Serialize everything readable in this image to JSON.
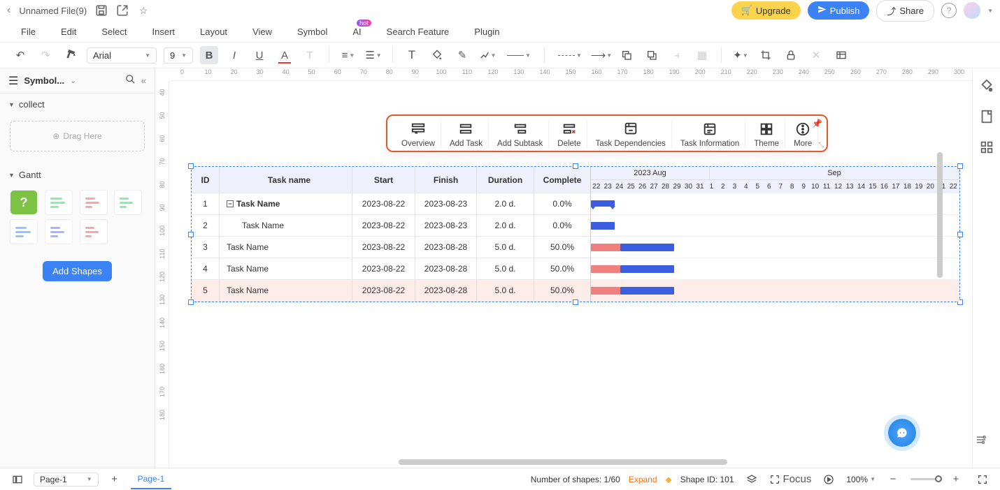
{
  "file": {
    "name": "Unnamed File(9)"
  },
  "topbar": {
    "upgrade": "Upgrade",
    "publish": "Publish",
    "share": "Share"
  },
  "menu": [
    "File",
    "Edit",
    "Select",
    "Insert",
    "Layout",
    "View",
    "Symbol",
    "AI",
    "Search Feature",
    "Plugin"
  ],
  "ai_badge": "hot",
  "toolbar": {
    "font": "Arial",
    "size": "9"
  },
  "sidebar": {
    "title": "Symbol...",
    "collect": "collect",
    "drag": "Drag Here",
    "gantt": "Gantt",
    "add_shapes": "Add Shapes"
  },
  "ruler_h": [
    "0",
    "10",
    "20",
    "30",
    "40",
    "50",
    "60",
    "70",
    "80",
    "90",
    "100",
    "110",
    "120",
    "130",
    "140",
    "150",
    "160",
    "170",
    "180",
    "190",
    "200",
    "210",
    "220",
    "230",
    "240",
    "250",
    "260",
    "270",
    "280",
    "290",
    "300"
  ],
  "ruler_v": [
    "40",
    "50",
    "60",
    "70",
    "80",
    "90",
    "100",
    "110",
    "120",
    "130",
    "140",
    "150",
    "160",
    "170",
    "180"
  ],
  "float": {
    "overview": "Overview",
    "add_task": "Add Task",
    "add_subtask": "Add Subtask",
    "delete": "Delete",
    "deps": "Task Dependencies",
    "info": "Task Information",
    "theme": "Theme",
    "more": "More"
  },
  "gantt": {
    "headers": {
      "id": "ID",
      "name": "Task name",
      "start": "Start",
      "finish": "Finish",
      "duration": "Duration",
      "complete": "Complete"
    },
    "months": {
      "aug": "2023 Aug",
      "sep": "Sep"
    },
    "days": [
      "22",
      "23",
      "24",
      "25",
      "26",
      "27",
      "28",
      "29",
      "30",
      "31",
      "1",
      "2",
      "3",
      "4",
      "5",
      "6",
      "7",
      "8",
      "9",
      "10",
      "11",
      "12",
      "13",
      "14",
      "15",
      "16",
      "17",
      "18",
      "19",
      "20",
      "21",
      "22"
    ],
    "rows": [
      {
        "id": "1",
        "name": "Task Name",
        "start": "2023-08-22",
        "finish": "2023-08-23",
        "dur": "2.0 d.",
        "comp": "0.0%",
        "bold": true,
        "collapse": true
      },
      {
        "id": "2",
        "name": "Task Name",
        "start": "2023-08-22",
        "finish": "2023-08-23",
        "dur": "2.0 d.",
        "comp": "0.0%",
        "indent": true
      },
      {
        "id": "3",
        "name": "Task Name",
        "start": "2023-08-22",
        "finish": "2023-08-28",
        "dur": "5.0 d.",
        "comp": "50.0%"
      },
      {
        "id": "4",
        "name": "Task Name",
        "start": "2023-08-22",
        "finish": "2023-08-28",
        "dur": "5.0 d.",
        "comp": "50.0%"
      },
      {
        "id": "5",
        "name": "Task Name",
        "start": "2023-08-22",
        "finish": "2023-08-28",
        "dur": "5.0 d.",
        "comp": "50.0%",
        "highlight": true
      }
    ]
  },
  "bottom": {
    "page_sel": "Page-1",
    "page_tab": "Page-1",
    "shapes": "Number of shapes: 1/60",
    "expand": "Expand",
    "shape_id": "Shape ID: 101",
    "focus": "Focus",
    "zoom": "100%"
  }
}
